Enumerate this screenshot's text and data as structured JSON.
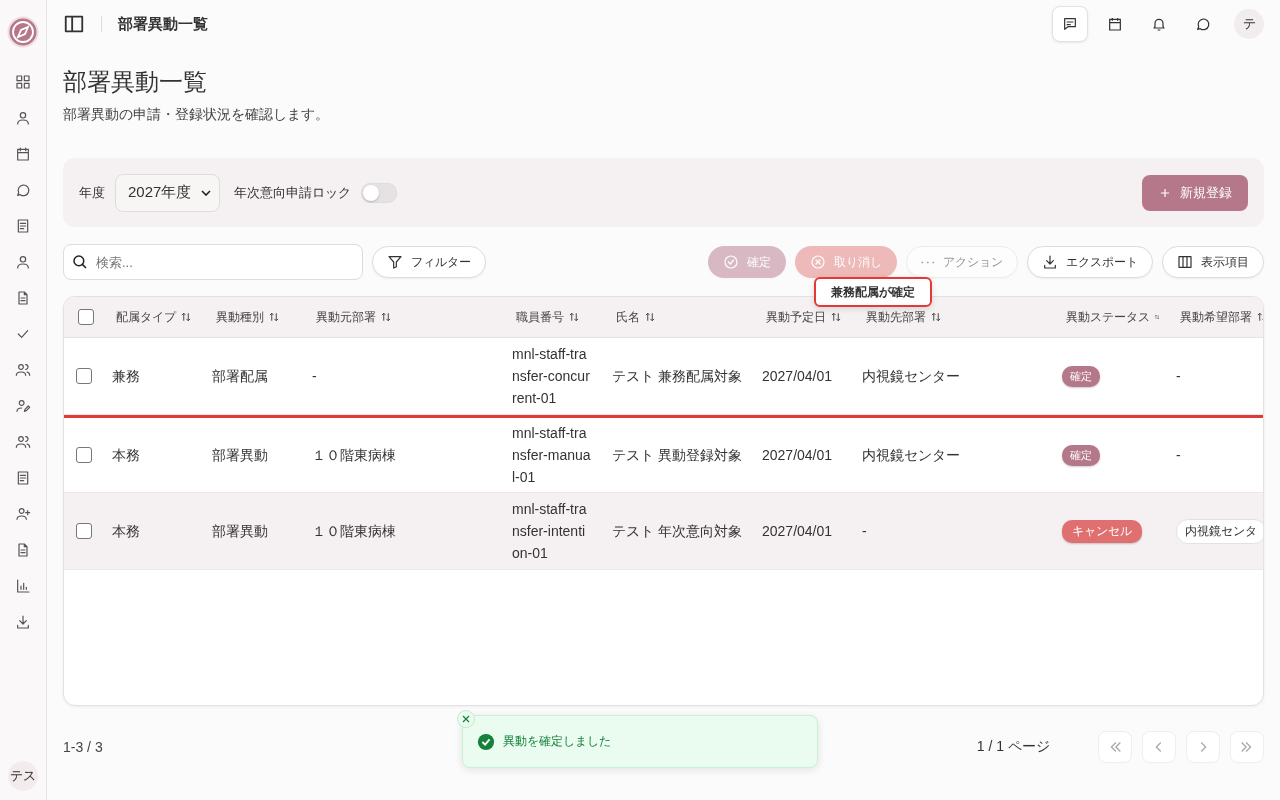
{
  "sidebar": {
    "avatar": "テス"
  },
  "header": {
    "title": "部署異動一覧",
    "avatar": "テ"
  },
  "page": {
    "title": "部署異動一覧",
    "subtitle": "部署異動の申請・登録状況を確認します。"
  },
  "filters": {
    "year_label": "年度",
    "year_value": "2027年度",
    "lock_label": "年次意向申請ロック",
    "lock_on": false,
    "new_button": "新規登録"
  },
  "search": {
    "placeholder": "検索..."
  },
  "filter_button": "フィルター",
  "actions": [
    {
      "label": "確定",
      "kind": "confirm",
      "disabled": true
    },
    {
      "label": "取り消し",
      "kind": "cancel",
      "disabled": true
    },
    {
      "label": "アクション",
      "kind": "more",
      "disabled": true
    },
    {
      "label": "エクスポート",
      "kind": "export",
      "disabled": false
    },
    {
      "label": "表示項目",
      "kind": "columns",
      "disabled": false
    }
  ],
  "tooltip": "兼務配属が確定",
  "table": {
    "all_checked": false,
    "columns": [
      "配属タイプ",
      "異動種別",
      "異動元部署",
      "職員番号",
      "氏名",
      "異動予定日",
      "異動先部署",
      "異動ステータス",
      "異動希望部署"
    ],
    "rows": [
      {
        "checked": false,
        "hovered": false,
        "drop_above": false,
        "cells": [
          "兼務",
          "部署配属",
          "-",
          "mnl-staff-transfer-concurrent-01",
          "テスト 兼務配属対象",
          "2027/04/01",
          "内視鏡センター"
        ],
        "status": {
          "label": "確定",
          "kind": "confirmed"
        },
        "wish": {
          "text": "-",
          "kind": "plain"
        }
      },
      {
        "checked": false,
        "hovered": false,
        "drop_above": true,
        "cells": [
          "本務",
          "部署異動",
          "１０階東病棟",
          "mnl-staff-transfer-manual-01",
          "テスト 異動登録対象",
          "2027/04/01",
          "内視鏡センター"
        ],
        "status": {
          "label": "確定",
          "kind": "confirmed"
        },
        "wish": {
          "text": "-",
          "kind": "plain"
        }
      },
      {
        "checked": false,
        "hovered": true,
        "drop_above": false,
        "cells": [
          "本務",
          "部署異動",
          "１０階東病棟",
          "mnl-staff-transfer-intention-01",
          "テスト 年次意向対象",
          "2027/04/01",
          "-"
        ],
        "status": {
          "label": "キャンセル",
          "kind": "cancelled"
        },
        "wish": {
          "text": "内視鏡センタ",
          "kind": "chip"
        }
      }
    ]
  },
  "footer": {
    "count": "1-3 / 3",
    "page": "1 / 1 ページ"
  },
  "toast": {
    "message": "異動を確定しました"
  }
}
